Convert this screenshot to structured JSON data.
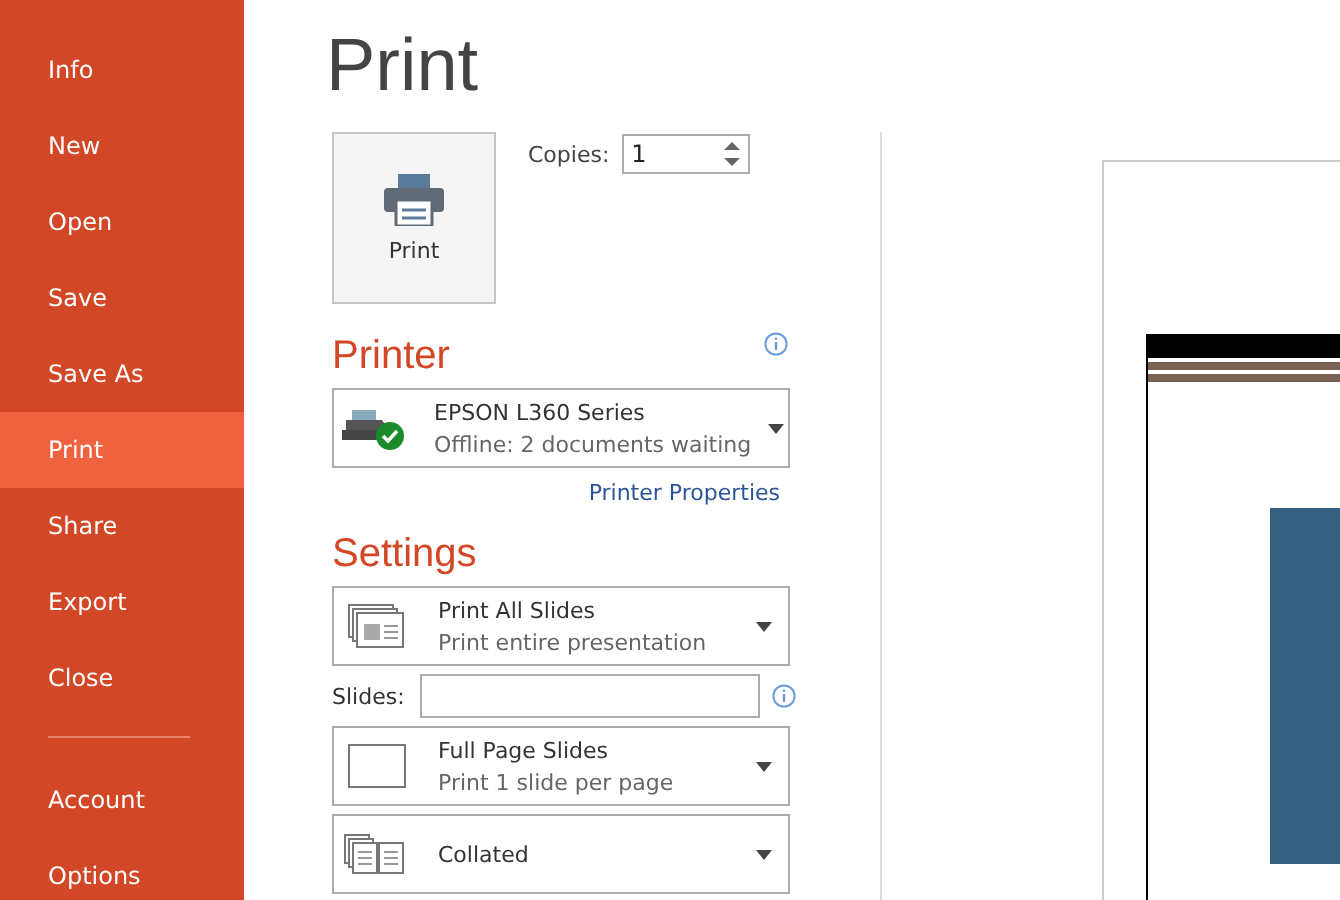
{
  "sidebar": {
    "items": [
      {
        "label": "Info",
        "selected": false
      },
      {
        "label": "New",
        "selected": false
      },
      {
        "label": "Open",
        "selected": false
      },
      {
        "label": "Save",
        "selected": false
      },
      {
        "label": "Save As",
        "selected": false
      },
      {
        "label": "Print",
        "selected": true
      },
      {
        "label": "Share",
        "selected": false
      },
      {
        "label": "Export",
        "selected": false
      },
      {
        "label": "Close",
        "selected": false
      }
    ],
    "footer_items": [
      {
        "label": "Account",
        "selected": false
      },
      {
        "label": "Options",
        "selected": false
      }
    ]
  },
  "title": "Print",
  "print_button": {
    "label": "Print"
  },
  "copies": {
    "label": "Copies:",
    "value": "1"
  },
  "printer": {
    "heading": "Printer",
    "name": "EPSON L360 Series",
    "status": "Offline: 2 documents waiting",
    "properties_link": "Printer Properties"
  },
  "settings": {
    "heading": "Settings",
    "options": [
      {
        "kind": "range",
        "title": "Print All Slides",
        "subtitle": "Print entire presentation"
      },
      {
        "kind": "field",
        "label": "Slides:"
      },
      {
        "kind": "layout",
        "title": "Full Page Slides",
        "subtitle": "Print 1 slide per page"
      },
      {
        "kind": "collate",
        "title": "Collated"
      }
    ]
  }
}
